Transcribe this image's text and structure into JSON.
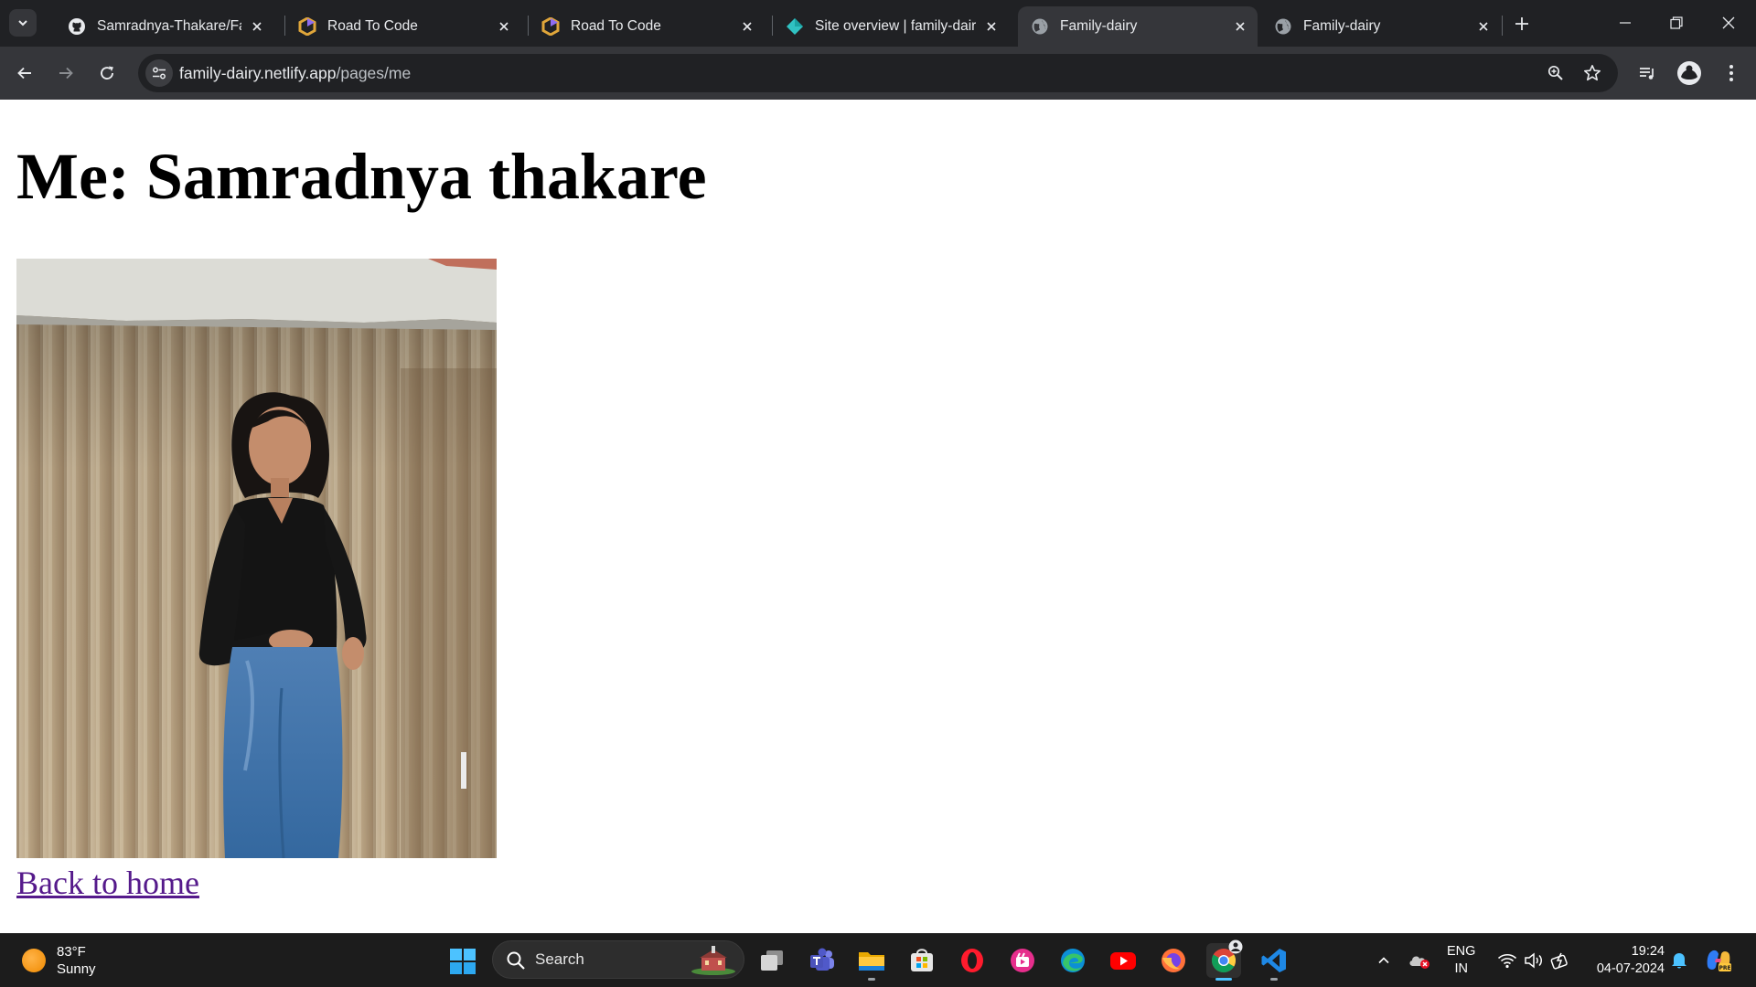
{
  "browser": {
    "tabs": [
      {
        "title": "Samradnya-Thakare/Family",
        "favicon": "github-icon"
      },
      {
        "title": "Road To Code",
        "favicon": "road-to-code-icon"
      },
      {
        "title": "Road To Code",
        "favicon": "road-to-code-icon"
      },
      {
        "title": "Site overview | family-dairy",
        "favicon": "netlify-icon"
      },
      {
        "title": "Family-dairy",
        "favicon": "globe-icon",
        "active": true
      },
      {
        "title": "Family-dairy",
        "favicon": "globe-icon"
      }
    ],
    "address": {
      "host": "family-dairy.netlify.app",
      "path": "/pages/me"
    }
  },
  "page": {
    "heading": "Me: Samradnya thakare",
    "photo_alt": "portrait photo",
    "back_link": "Back to home"
  },
  "taskbar": {
    "weather": {
      "temp": "83°F",
      "condition": "Sunny"
    },
    "search_label": "Search",
    "apps": [
      "task-view",
      "teams",
      "file-explorer",
      "microsoft-store",
      "opera",
      "clipchamp",
      "edge",
      "youtube",
      "firefox",
      "chrome",
      "vscode"
    ],
    "language": {
      "line1": "ENG",
      "line2": "IN"
    },
    "clock": {
      "time": "19:24",
      "date": "04-07-2024"
    }
  },
  "colors": {
    "tabstrip": "#202124",
    "toolbar": "#35363a",
    "link_visited": "#551a8b",
    "taskbar": "#1c1c1c"
  }
}
